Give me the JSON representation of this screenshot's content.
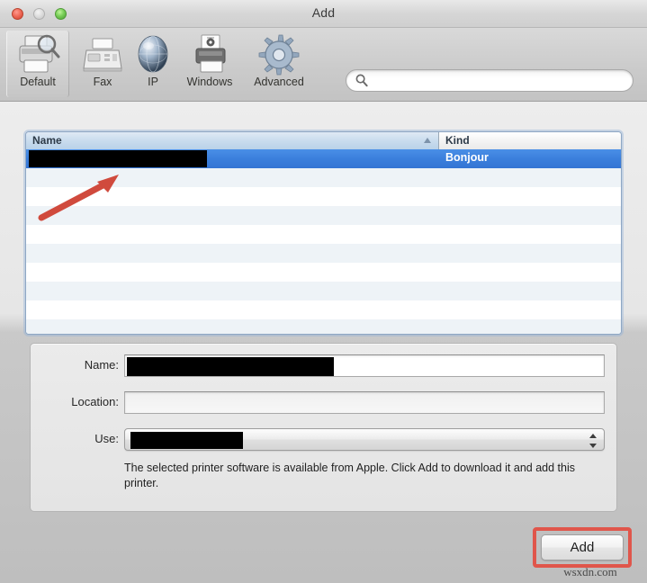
{
  "window": {
    "title": "Add",
    "controls": {
      "close": "close-button",
      "minimize": "minimize-button",
      "zoom": "zoom-button"
    }
  },
  "toolbar": {
    "items": [
      {
        "label": "Default",
        "icon": "printer-magnifier-icon",
        "selected": true
      },
      {
        "label": "Fax",
        "icon": "fax-machine-icon",
        "selected": false
      },
      {
        "label": "IP",
        "icon": "globe-icon",
        "selected": false
      },
      {
        "label": "Windows",
        "icon": "network-printer-icon",
        "selected": false
      },
      {
        "label": "Advanced",
        "icon": "gear-icon",
        "selected": false
      }
    ],
    "search": {
      "value": "",
      "placeholder": "",
      "label": "Search",
      "icon": "search-icon"
    }
  },
  "printer_list": {
    "columns": [
      {
        "label": "Name",
        "sorted": true,
        "sort_direction": "ascending"
      },
      {
        "label": "Kind",
        "sorted": false,
        "sort_direction": ""
      }
    ],
    "rows": [
      {
        "name": "",
        "name_redacted": true,
        "kind": "Bonjour",
        "selected": true
      }
    ],
    "empty_row_count": 10
  },
  "annotations": {
    "arrow": {
      "color": "#d04a3d",
      "points_to": "selected-printer-row"
    },
    "highlight_box": {
      "color": "#e0564b",
      "around": "add-button"
    }
  },
  "form": {
    "name": {
      "label": "Name:",
      "value": "",
      "redacted": true
    },
    "location": {
      "label": "Location:",
      "value": "",
      "placeholder": ""
    },
    "use": {
      "label": "Use:",
      "value": "",
      "redacted": true,
      "icon": "stepper-arrows-icon"
    },
    "help_text": "The selected printer software is available from Apple. Click Add to download it and add this printer."
  },
  "footer": {
    "add_label": "Add",
    "watermark": "wsxdn.com"
  }
}
